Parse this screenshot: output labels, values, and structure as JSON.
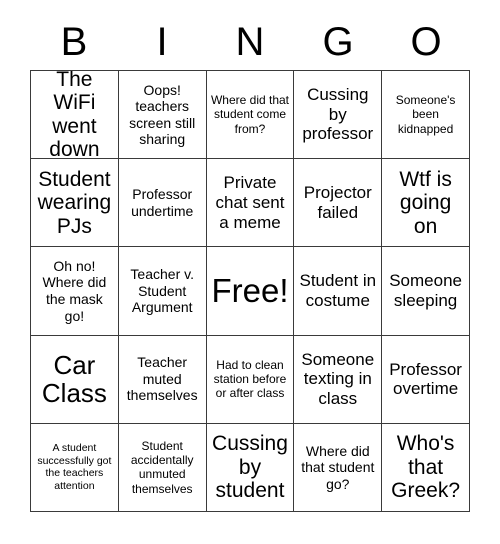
{
  "card": {
    "title": "BINGO",
    "header_letters": [
      "B",
      "I",
      "N",
      "G",
      "O"
    ],
    "grid_size": "5x5",
    "free_space_label": "Free!",
    "colors": {
      "background": "#ffffff",
      "border": "#3a3a3a",
      "text": "#000000"
    },
    "rows": [
      [
        {
          "text": "The WiFi went down",
          "size": "lg"
        },
        {
          "text": "Oops! teachers screen still sharing",
          "size": "sm"
        },
        {
          "text": "Where did that student come from?",
          "size": "xs"
        },
        {
          "text": "Cussing by professor",
          "size": "md"
        },
        {
          "text": "Someone's been kidnapped",
          "size": "xs"
        }
      ],
      [
        {
          "text": "Student wearing PJs",
          "size": "lg"
        },
        {
          "text": "Professor undertime",
          "size": "sm"
        },
        {
          "text": "Private chat sent a meme",
          "size": "md"
        },
        {
          "text": "Projector failed",
          "size": "md"
        },
        {
          "text": "Wtf is going on",
          "size": "lg"
        }
      ],
      [
        {
          "text": "Oh no! Where did the mask go!",
          "size": "sm"
        },
        {
          "text": "Teacher v. Student Argument",
          "size": "sm"
        },
        {
          "text": "Free!",
          "size": "xxl"
        },
        {
          "text": "Student in costume",
          "size": "md"
        },
        {
          "text": "Someone sleeping",
          "size": "md"
        }
      ],
      [
        {
          "text": "Car Class",
          "size": "xl"
        },
        {
          "text": "Teacher muted themselves",
          "size": "sm"
        },
        {
          "text": "Had to clean station before or after class",
          "size": "xs"
        },
        {
          "text": "Someone texting in class",
          "size": "md"
        },
        {
          "text": "Professor overtime",
          "size": "md"
        }
      ],
      [
        {
          "text": "A student successfully got the teachers attention",
          "size": "xxs"
        },
        {
          "text": "Student accidentally unmuted themselves",
          "size": "xs"
        },
        {
          "text": "Cussing by student",
          "size": "lg"
        },
        {
          "text": "Where did that student go?",
          "size": "sm"
        },
        {
          "text": "Who's that Greek?",
          "size": "lg"
        }
      ]
    ]
  }
}
